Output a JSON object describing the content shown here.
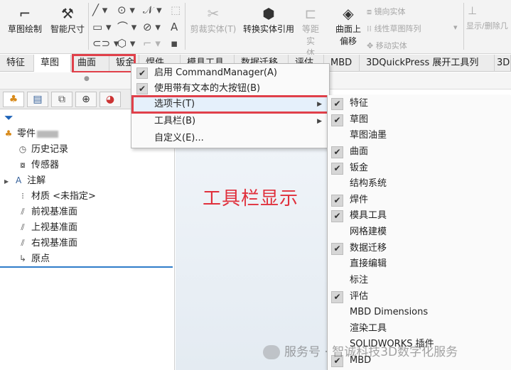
{
  "ribbon": {
    "sketch": "草图绘制",
    "smart_dim": "智能尺寸",
    "trim": "剪裁实体(T)",
    "convert": "转换实体引用",
    "offset_line1": "等距实",
    "offset_line2": "体",
    "surface_offset_line1": "曲面上",
    "surface_offset_line2": "偏移",
    "mirror": "镜向实体",
    "linear_pattern": "线性草图阵列",
    "move": "移动实体",
    "show_delete": "显示/删除几"
  },
  "tabs": [
    "特征",
    "草图",
    "曲面",
    "钣金",
    "焊件",
    "模具工具",
    "数据迁移",
    "评估",
    "MBD",
    "3DQuickPress 展开工具列",
    "3D"
  ],
  "context_menu": {
    "items": [
      {
        "label": "启用 CommandManager(A)",
        "checked": true
      },
      {
        "label": "使用带有文本的大按钮(B)",
        "checked": true
      },
      {
        "label": "选项卡(T)",
        "checked": false,
        "submenu": true
      },
      {
        "label": "工具栏(B)",
        "checked": false,
        "submenu": true
      },
      {
        "label": "自定义(E)...",
        "checked": false
      }
    ]
  },
  "submenu": {
    "items": [
      {
        "label": "特征",
        "checked": true
      },
      {
        "label": "草图",
        "checked": true
      },
      {
        "label": "草图油墨",
        "checked": false
      },
      {
        "label": "曲面",
        "checked": true
      },
      {
        "label": "钣金",
        "checked": true
      },
      {
        "label": "结构系统",
        "checked": false
      },
      {
        "label": "焊件",
        "checked": true
      },
      {
        "label": "模具工具",
        "checked": true
      },
      {
        "label": "网格建模",
        "checked": false
      },
      {
        "label": "数据迁移",
        "checked": true
      },
      {
        "label": "直接编辑",
        "checked": false
      },
      {
        "label": "标注",
        "checked": false
      },
      {
        "label": "评估",
        "checked": true
      },
      {
        "label": "MBD Dimensions",
        "checked": false
      },
      {
        "label": "渲染工具",
        "checked": false
      },
      {
        "label": "SOLIDWORKS 插件",
        "checked": false
      },
      {
        "label": "MBD",
        "checked": true
      }
    ]
  },
  "tree": {
    "part": "零件",
    "items": [
      "历史记录",
      "传感器",
      "注解",
      "材质 <未指定>",
      "前视基准面",
      "上视基准面",
      "右视基准面",
      "原点"
    ]
  },
  "annotation": "工具栏显示",
  "watermark": "服务号 · 智诚科技3D数字化服务",
  "check_glyph": "✔",
  "arrow_glyph": "▶"
}
